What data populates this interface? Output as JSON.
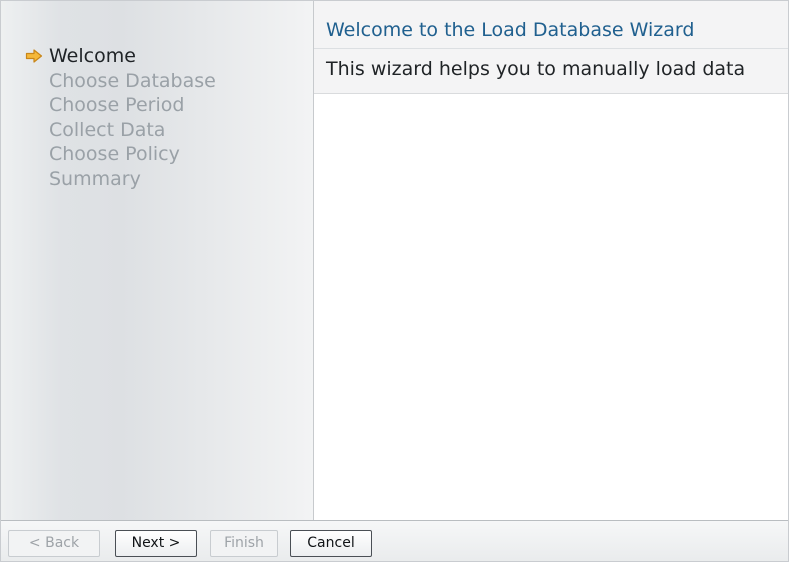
{
  "wizard": {
    "steps": [
      {
        "label": "Welcome",
        "current": true
      },
      {
        "label": "Choose Database",
        "current": false
      },
      {
        "label": "Choose Period",
        "current": false
      },
      {
        "label": "Collect Data",
        "current": false
      },
      {
        "label": "Choose Policy",
        "current": false
      },
      {
        "label": "Summary",
        "current": false
      }
    ],
    "current_step_icon": "right-arrow-icon",
    "title": "Welcome to the Load Database Wizard",
    "description": "This wizard helps you to manually load data"
  },
  "buttons": {
    "back": "< Back",
    "next": "Next >",
    "finish": "Finish",
    "cancel": "Cancel"
  },
  "colors": {
    "title": "#20608f",
    "current_step_arrow": "#f0a830",
    "inactive_step_text": "#9aa1a7"
  }
}
